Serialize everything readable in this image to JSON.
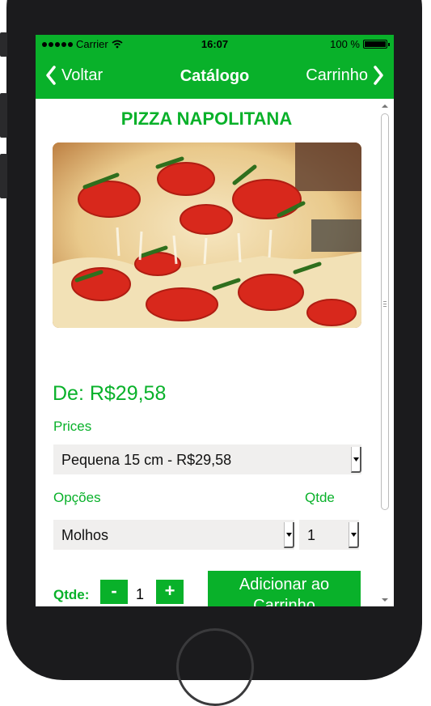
{
  "status": {
    "carrier": "Carrier",
    "time": "16:07",
    "battery": "100 %"
  },
  "nav": {
    "back": "Voltar",
    "title": "Catálogo",
    "cart": "Carrinho"
  },
  "product": {
    "title": "PIZZA NAPOLITANA",
    "image": "pizza-napolitana-photo"
  },
  "price_from": "De: R$29,58",
  "prices_label": "Prices",
  "prices_selected": "Pequena 15 cm - R$29,58",
  "options_label": "Opções",
  "options_qty_label": "Qtde",
  "options_selected": "Molhos",
  "options_qty_selected": "1",
  "qty": {
    "label": "Qtde:",
    "minus": "-",
    "value": "1",
    "plus": "+"
  },
  "add_to_cart_line1": "Adicionar ao",
  "add_to_cart_line2": "Carrinho",
  "colors": {
    "accent": "#09b12a",
    "field_bg": "#f0efee"
  },
  "icons": {
    "back": "chevron-left-icon",
    "cart": "chevron-right-icon",
    "wifi": "wifi-icon",
    "battery": "battery-icon",
    "dropdown": "dropdown-arrow-icon"
  }
}
